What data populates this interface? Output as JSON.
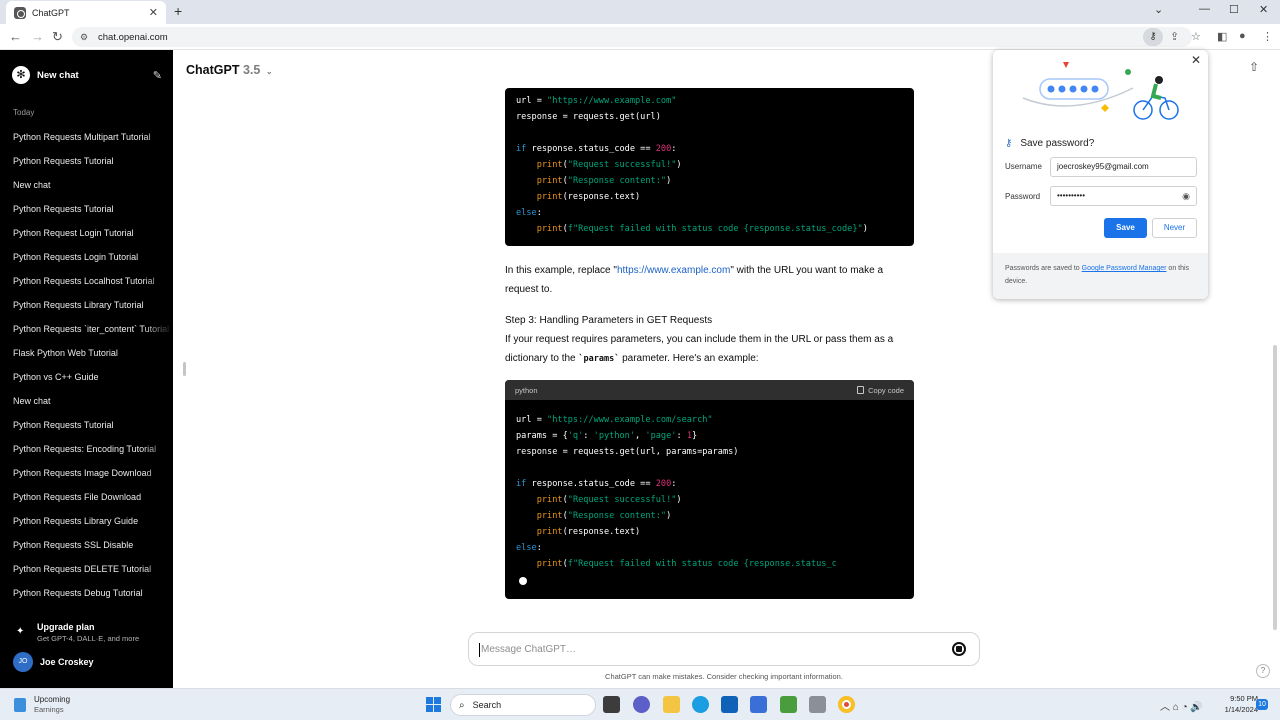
{
  "browser": {
    "tab_title": "ChatGPT",
    "url": "chat.openai.com"
  },
  "sidebar": {
    "new_chat_label": "New chat",
    "section_today": "Today",
    "items": [
      "Python Requests Multipart Tutorial",
      "Python Requests Tutorial",
      "New chat",
      "Python Requests Tutorial",
      "Python Request Login Tutorial",
      "Python Requests Login Tutorial",
      "Python Requests Localhost Tutorial",
      "Python Requests Library Tutorial",
      "Python Requests `iter_content` Tutorial",
      "Flask Python Web Tutorial",
      "Python vs C++ Guide",
      "New chat",
      "Python Requests Tutorial",
      "Python Requests: Encoding Tutorial",
      "Python Requests Image Download",
      "Python Requests File Download",
      "Python Requests Library Guide",
      "Python Requests SSL Disable",
      "Python Requests DELETE Tutorial",
      "Python Requests Debug Tutorial"
    ],
    "upgrade_title": "Upgrade plan",
    "upgrade_sub": "Get GPT-4, DALL·E, and more",
    "user_initials": "JO",
    "user_name": "Joe Croskey"
  },
  "header": {
    "model_name": "ChatGPT",
    "model_version": "3.5"
  },
  "content": {
    "code1_lines": [
      "url = \"https://www.example.com\"",
      "response = requests.get(url)",
      "",
      "if response.status_code == 200:",
      "    print(\"Request successful!\")",
      "    print(\"Response content:\")",
      "    print(response.text)",
      "else:",
      "    print(f\"Request failed with status code {response.status_code}\")"
    ],
    "para1_a": "In this example, replace \"",
    "para1_link": "https://www.example.com",
    "para1_b": "\" with the URL you want to make a request to.",
    "step3_heading": "Step 3: Handling Parameters in GET Requests",
    "para2_a": "If your request requires parameters, you can include them in the URL or pass them as a dictionary to the ",
    "para2_code": "`params`",
    "para2_b": " parameter. Here's an example:",
    "code2_lang": "python",
    "code2_copy": "Copy code",
    "code2_lines": [
      "url = \"https://www.example.com/search\"",
      "params = {'q': 'python', 'page': 1}",
      "response = requests.get(url, params=params)",
      "",
      "if response.status_code == 200:",
      "    print(\"Request successful!\")",
      "    print(\"Response content:\")",
      "    print(response.text)",
      "else:",
      "    print(f\"Request failed with status code {response.status_c"
    ]
  },
  "composer": {
    "placeholder": "Message ChatGPT…",
    "disclaimer": "ChatGPT can make mistakes. Consider checking important information."
  },
  "password_popup": {
    "title": "Save password?",
    "username_label": "Username",
    "username_value": "joecroskey95@gmail.com",
    "password_label": "Password",
    "password_value": "••••••••••",
    "save_label": "Save",
    "never_label": "Never",
    "footer_a": "Passwords are saved to ",
    "footer_link": "Google Password Manager",
    "footer_b": " on this device."
  },
  "taskbar": {
    "weather_title": "Upcoming",
    "weather_sub": "Earnings",
    "search_label": "Search",
    "time": "9:50 PM",
    "date": "1/14/2024",
    "notif_count": "10"
  },
  "colors": {
    "sidebar_bg": "#000000",
    "save_button": "#1a73e8",
    "code_bg": "#000000",
    "string": "#00a67d",
    "keyword": "#2e95d3",
    "number": "#df3079"
  }
}
